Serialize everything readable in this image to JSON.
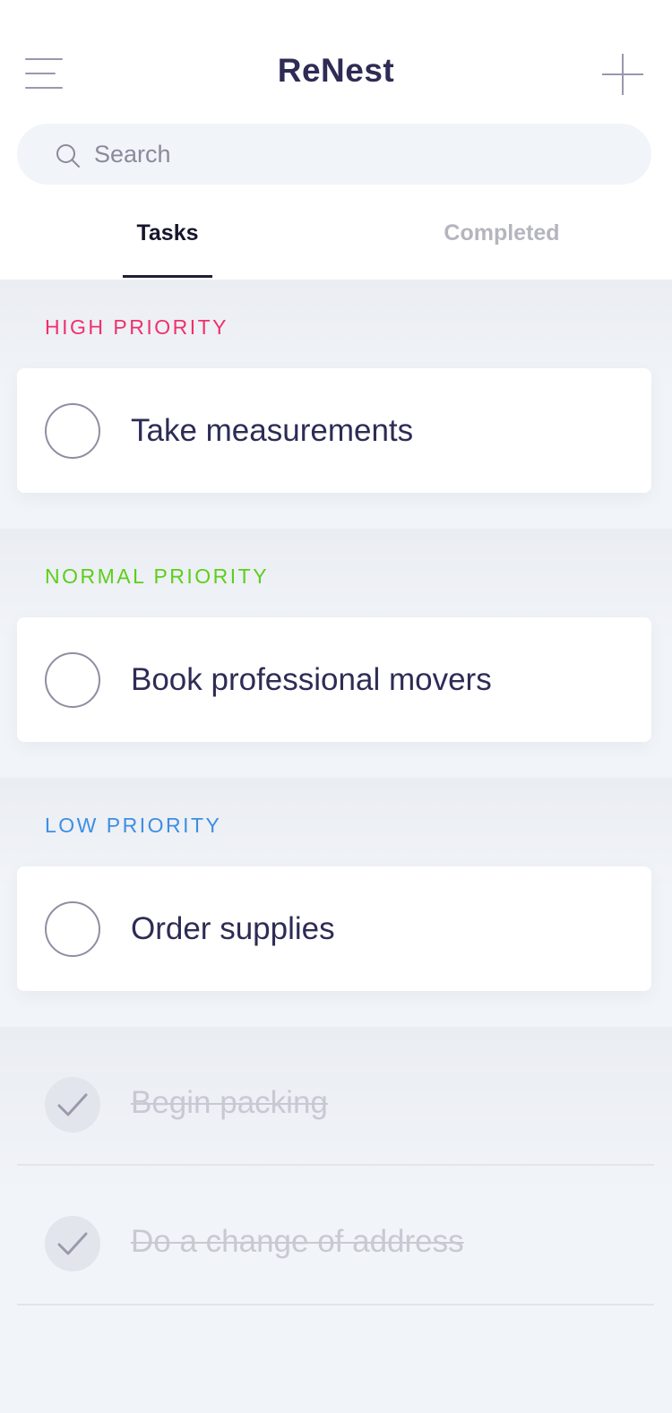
{
  "header": {
    "title": "ReNest",
    "menu_icon": "hamburger-menu-icon",
    "add_icon": "plus-icon"
  },
  "search": {
    "placeholder": "Search",
    "value": "",
    "icon": "search-icon"
  },
  "tabs": [
    {
      "label": "Tasks",
      "active": true
    },
    {
      "label": "Completed",
      "active": false
    }
  ],
  "sections": [
    {
      "label": "HIGH PRIORITY",
      "color": "#f0306c",
      "tasks": [
        "Take measurements"
      ]
    },
    {
      "label": "NORMAL PRIORITY",
      "color": "#5ccf1a",
      "tasks": [
        "Book professional movers"
      ]
    },
    {
      "label": "LOW PRIORITY",
      "color": "#3d8ee4",
      "tasks": [
        "Order supplies"
      ]
    }
  ],
  "completed_tasks": [
    {
      "label": "Begin packing",
      "done": true
    },
    {
      "label": "Do a change of address",
      "done": true
    }
  ],
  "colors": {
    "title": "#2e2c55",
    "active_tab": "#16152c",
    "inactive_tab": "#b5b5bf",
    "background": "#f1f4f8"
  }
}
